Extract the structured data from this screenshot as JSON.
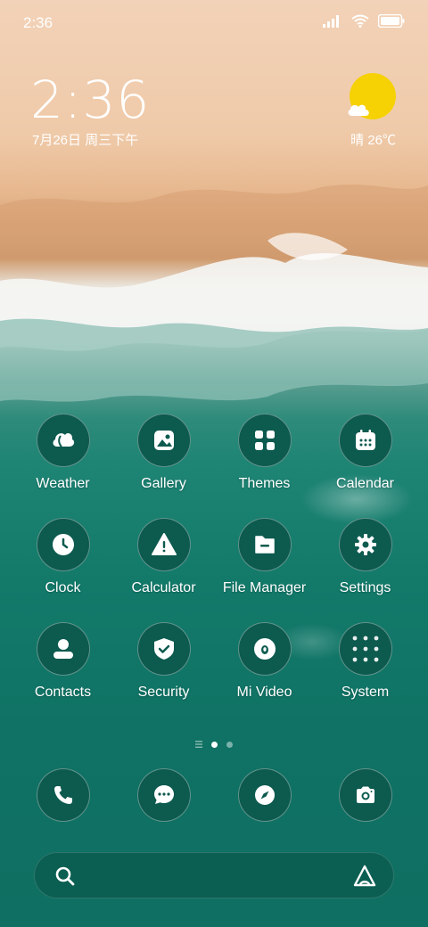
{
  "status_bar": {
    "time": "2:36"
  },
  "lockclock": {
    "time": "2:36",
    "date": "7月26日 周三下午",
    "weather": "晴 26℃"
  },
  "colors": {
    "sun": "#f6d104",
    "icon_bg": "#0d5a4f",
    "water": "#137a6a",
    "sand": "#efcaa9"
  },
  "apps": [
    {
      "label": "Weather",
      "icon": "weather-icon"
    },
    {
      "label": "Gallery",
      "icon": "gallery-icon"
    },
    {
      "label": "Themes",
      "icon": "themes-icon"
    },
    {
      "label": "Calendar",
      "icon": "calendar-icon"
    },
    {
      "label": "Clock",
      "icon": "clock-icon"
    },
    {
      "label": "Calculator",
      "icon": "calculator-icon"
    },
    {
      "label": "File Manager",
      "icon": "file-manager-icon"
    },
    {
      "label": "Settings",
      "icon": "settings-icon"
    },
    {
      "label": "Contacts",
      "icon": "contacts-icon"
    },
    {
      "label": "Security",
      "icon": "security-icon"
    },
    {
      "label": "Mi Video",
      "icon": "mi-video-icon"
    },
    {
      "label": "System",
      "icon": "system-folder-icon"
    }
  ],
  "page_indicator": {
    "pages": 2,
    "current": 1
  },
  "dock": [
    {
      "icon": "phone-icon"
    },
    {
      "icon": "messages-icon"
    },
    {
      "icon": "browser-icon"
    },
    {
      "icon": "camera-icon"
    }
  ]
}
